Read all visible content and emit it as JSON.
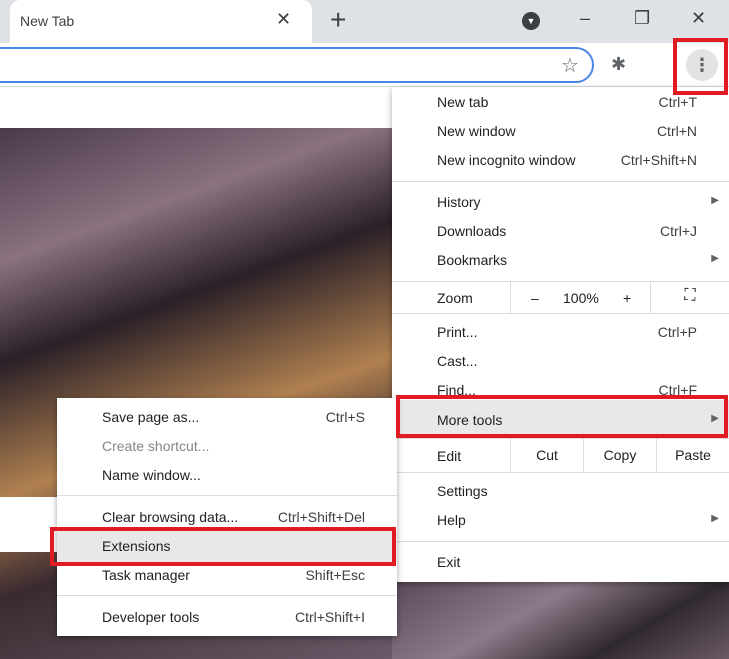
{
  "tab": {
    "title": "New Tab",
    "close": "✕",
    "new_tab": "+"
  },
  "window": {
    "profile": "▼",
    "minimize": "–",
    "restore": "❐",
    "close": "✕"
  },
  "toolbar": {
    "star": "☆",
    "extensions": "✱",
    "menu": "⋮"
  },
  "main_menu": {
    "new_tab": {
      "label": "New tab",
      "shortcut": "Ctrl+T"
    },
    "new_window": {
      "label": "New window",
      "shortcut": "Ctrl+N"
    },
    "incognito": {
      "label": "New incognito window",
      "shortcut": "Ctrl+Shift+N"
    },
    "history": {
      "label": "History",
      "arrow": "▶"
    },
    "downloads": {
      "label": "Downloads",
      "shortcut": "Ctrl+J"
    },
    "bookmarks": {
      "label": "Bookmarks",
      "arrow": "▶"
    },
    "zoom": {
      "label": "Zoom",
      "minus": "–",
      "value": "100%",
      "plus": "+",
      "fullscreen": "⛶"
    },
    "print": {
      "label": "Print...",
      "shortcut": "Ctrl+P"
    },
    "cast": {
      "label": "Cast..."
    },
    "find": {
      "label": "Find...",
      "shortcut": "Ctrl+F"
    },
    "more_tools": {
      "label": "More tools",
      "arrow": "▶"
    },
    "edit": {
      "label": "Edit",
      "cut": "Cut",
      "copy": "Copy",
      "paste": "Paste"
    },
    "settings": {
      "label": "Settings"
    },
    "help": {
      "label": "Help",
      "arrow": "▶"
    },
    "exit": {
      "label": "Exit"
    }
  },
  "sub_menu": {
    "save_page": {
      "label": "Save page as...",
      "shortcut": "Ctrl+S"
    },
    "create_shortcut": {
      "label": "Create shortcut..."
    },
    "name_window": {
      "label": "Name window..."
    },
    "clear_data": {
      "label": "Clear browsing data...",
      "shortcut": "Ctrl+Shift+Del"
    },
    "extensions": {
      "label": "Extensions"
    },
    "task_manager": {
      "label": "Task manager",
      "shortcut": "Shift+Esc"
    },
    "dev_tools": {
      "label": "Developer tools",
      "shortcut": "Ctrl+Shift+I"
    }
  }
}
